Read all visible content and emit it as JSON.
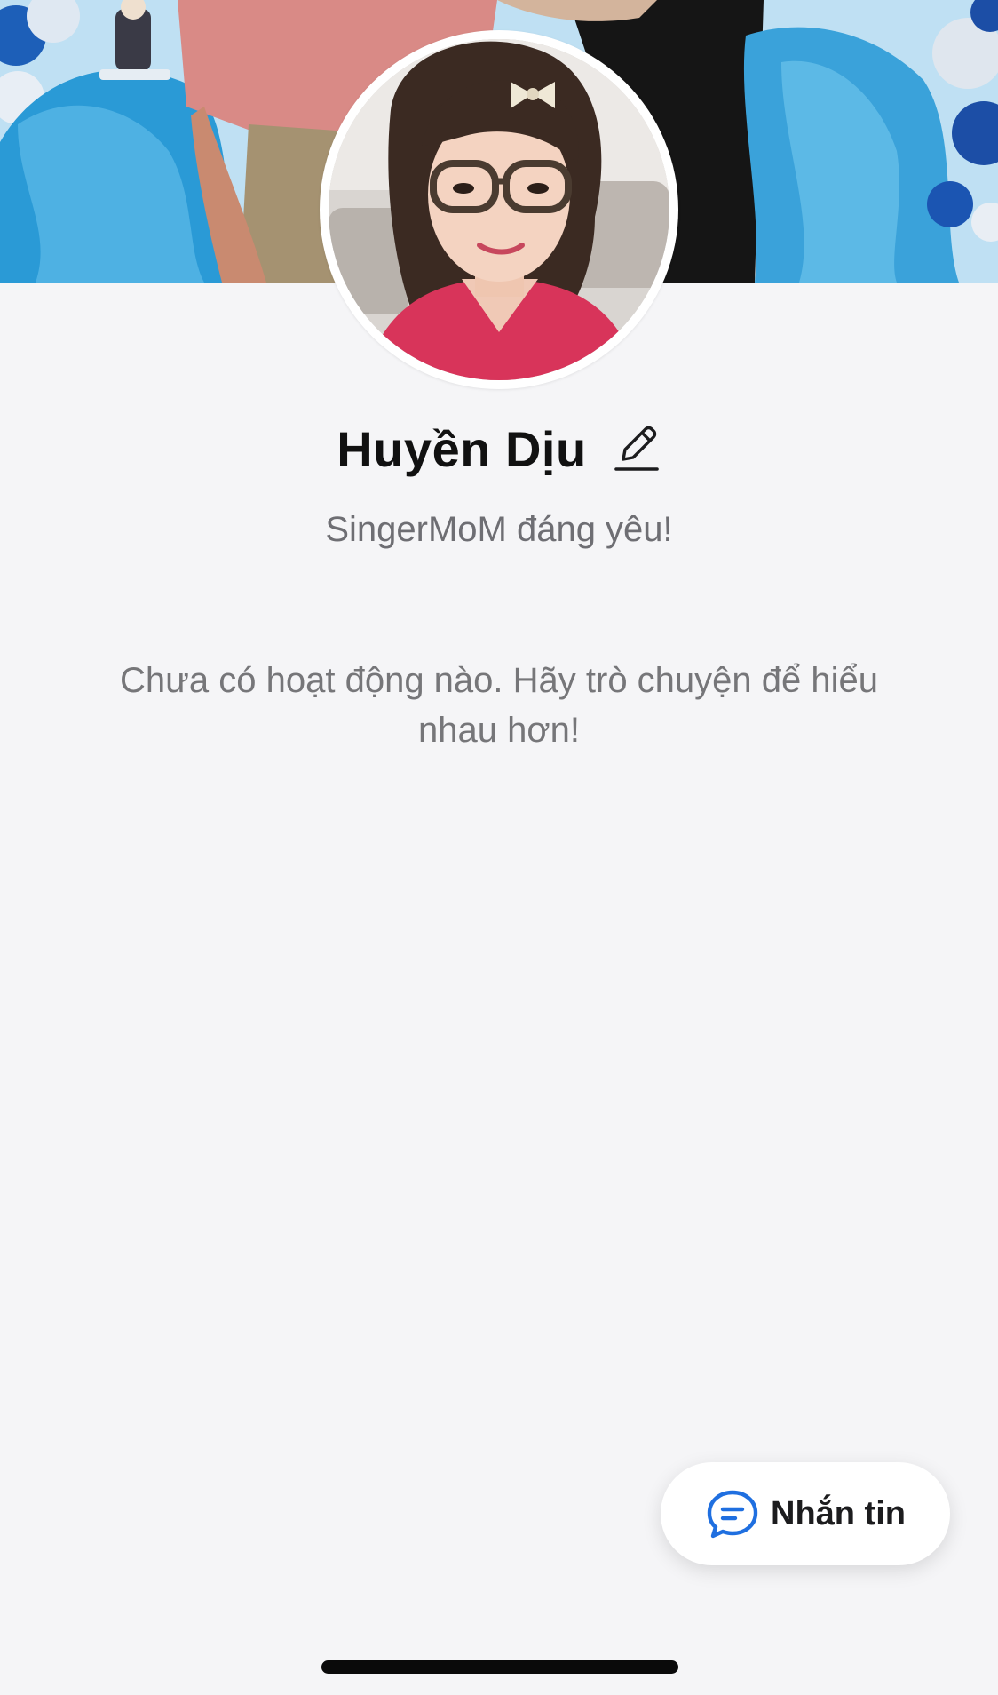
{
  "profile": {
    "name": "Huyền Dịu",
    "status": "SingerMoM đáng yêu!"
  },
  "activity": {
    "empty_message": "Chưa có hoạt động nào. Hãy trò chuyện để hiểu nhau hơn!"
  },
  "actions": {
    "message_label": "Nhắn tin"
  },
  "icons": {
    "edit": "pencil-icon",
    "message": "chat-bubble-icon"
  },
  "colors": {
    "background": "#f5f5f7",
    "accent": "#1f6fe0",
    "text_primary": "#111111",
    "text_secondary": "#6e6e73"
  }
}
